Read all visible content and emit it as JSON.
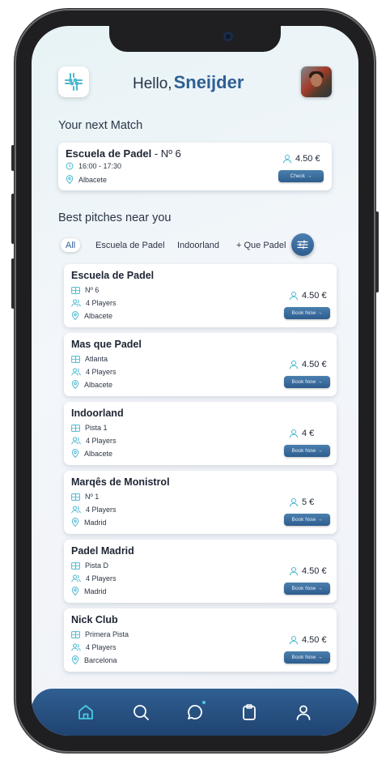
{
  "header": {
    "greeting": "Hello,",
    "user_name": "Sneijder"
  },
  "next_match": {
    "section_title": "Your next Match",
    "club": "Escuela de Padel",
    "court": "- Nº 6",
    "time": "16:00 - 17:30",
    "location": "Albacete",
    "price": "4.50 €",
    "button": "Check"
  },
  "pitches": {
    "section_title": "Best pitches near you",
    "filters": [
      "All",
      "Escuela de Padel",
      "Indoorland",
      "+ Que Padel"
    ],
    "items": [
      {
        "name": "Escuela de Padel",
        "court": "Nº 6",
        "players": "4 Players",
        "city": "Albacete",
        "price": "4.50 €",
        "button": "Book Now"
      },
      {
        "name": "Mas que Padel",
        "court": "Atlanta",
        "players": "4 Players",
        "city": "Albacete",
        "price": "4.50 €",
        "button": "Book Now"
      },
      {
        "name": "Indoorland",
        "court": "Pista 1",
        "players": "4 Players",
        "city": "Albacete",
        "price": "4 €",
        "button": "Book Now"
      },
      {
        "name": "Marqês de Monistrol",
        "court": "Nº 1",
        "players": "4 Players",
        "city": "Madrid",
        "price": "5 €",
        "button": "Book Now"
      },
      {
        "name": "Padel Madrid",
        "court": "Pista D",
        "players": "4 Players",
        "city": "Madrid",
        "price": "4.50 €",
        "button": "Book Now"
      },
      {
        "name": "Nick Club",
        "court": "Primera Pista",
        "players": "4 Players",
        "city": "Barcelona",
        "price": "4.50 €",
        "button": "Book Now"
      }
    ]
  },
  "tabbar": {
    "tabs": [
      "home-icon",
      "search-icon",
      "chat-icon",
      "clipboard-icon",
      "user-icon"
    ],
    "active_tab": "home-icon",
    "active_color": "#4cc8e0",
    "icon_color": "#ffffff"
  },
  "colors": {
    "brand": "#2e5f93",
    "accent": "#4cc8e0",
    "button": "#3a6c9e"
  }
}
